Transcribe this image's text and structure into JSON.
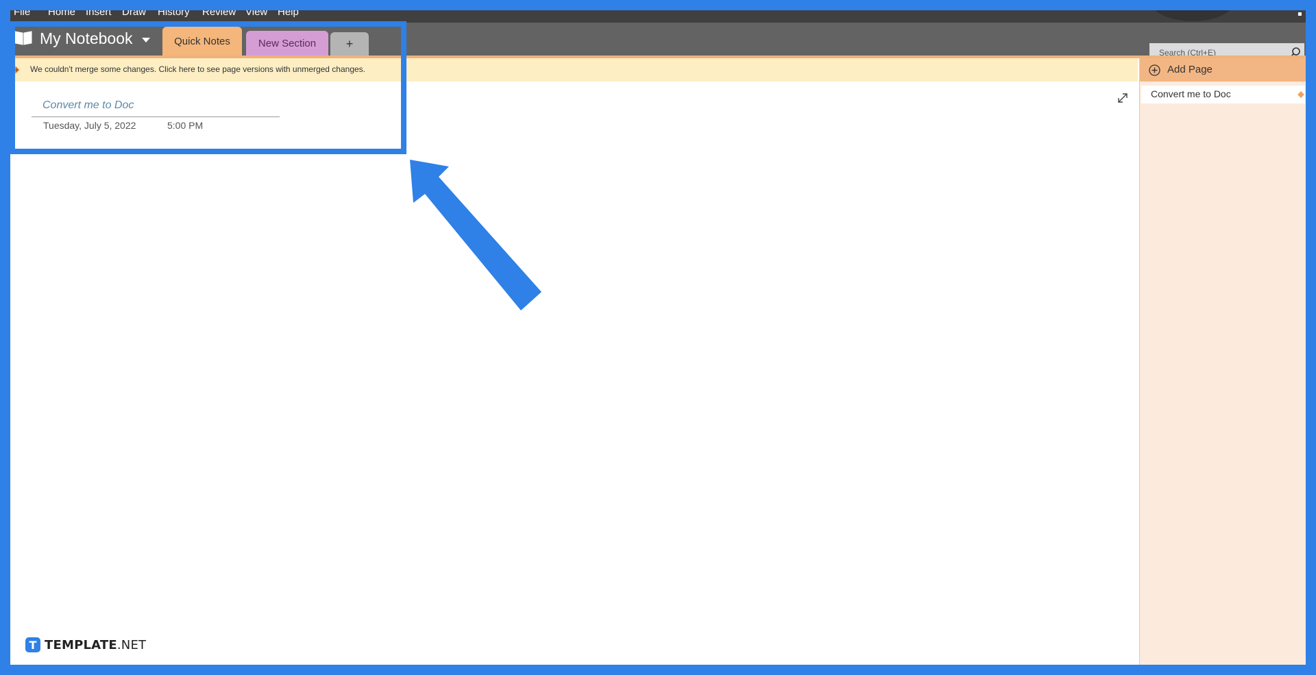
{
  "menu": {
    "items": [
      "File",
      "Home",
      "Insert",
      "Draw",
      "History",
      "Review",
      "View",
      "Help"
    ]
  },
  "notebook": {
    "title": "My Notebook",
    "icon": "notebook-icon"
  },
  "sections": {
    "tabs": [
      {
        "label": "Quick Notes",
        "color": "#f4b67b"
      },
      {
        "label": "New Section",
        "color": "#d49ed4"
      }
    ],
    "add_label": "+"
  },
  "search": {
    "placeholder": "Search (Ctrl+E)"
  },
  "warning": {
    "text": "We couldn't merge some changes. Click here to see page versions with unmerged changes."
  },
  "page": {
    "title": "Convert me to Doc",
    "date": "Tuesday, July 5, 2022",
    "time": "5:00 PM"
  },
  "pane": {
    "add_page_label": "Add Page",
    "pages": [
      {
        "label": "Convert me to Doc"
      }
    ]
  },
  "watermark": {
    "brand": "TEMPLATE",
    "suffix": ".NET",
    "logo_letter": "T"
  },
  "colors": {
    "highlight": "#2f80e7",
    "quick_notes": "#f4b67b",
    "new_section": "#d49ed4"
  }
}
